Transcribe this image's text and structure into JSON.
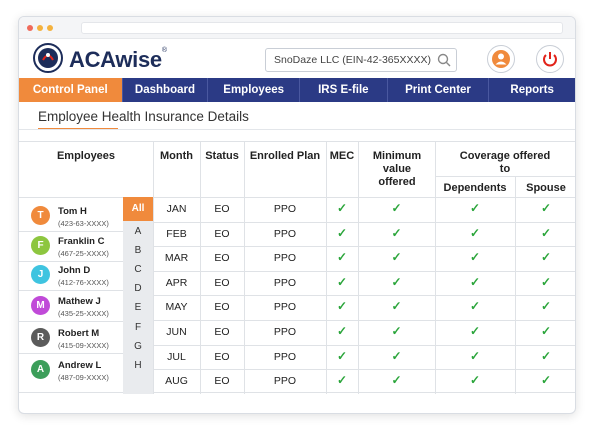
{
  "app": {
    "brand": "ACAwise",
    "brand_mark": "®",
    "company_selector": "SnoDaze LLC (EIN-42-365XXXX)"
  },
  "nav": {
    "tabs": [
      {
        "label": "Control Panel",
        "active": true
      },
      {
        "label": "Dashboard",
        "active": false
      },
      {
        "label": "Employees",
        "active": false
      },
      {
        "label": "IRS E-file",
        "active": false
      },
      {
        "label": "Print Center",
        "active": false
      },
      {
        "label": "Reports",
        "active": false
      }
    ]
  },
  "page": {
    "title": "Employee Health Insurance Details"
  },
  "table": {
    "headers": {
      "employees": "Employees",
      "month": "Month",
      "status": "Status",
      "plan": "Enrolled Plan",
      "mec": "MEC",
      "mv": "Minimum value offered",
      "coverage": "Coverage offered to",
      "dependents": "Dependents",
      "spouse": "Spouse"
    },
    "rows": [
      {
        "month": "JAN",
        "status": "EO",
        "plan": "PPO"
      },
      {
        "month": "FEB",
        "status": "EO",
        "plan": "PPO"
      },
      {
        "month": "MAR",
        "status": "EO",
        "plan": "PPO"
      },
      {
        "month": "APR",
        "status": "EO",
        "plan": "PPO"
      },
      {
        "month": "MAY",
        "status": "EO",
        "plan": "PPO"
      },
      {
        "month": "JUN",
        "status": "EO",
        "plan": "PPO"
      },
      {
        "month": "JUL",
        "status": "EO",
        "plan": "PPO"
      },
      {
        "month": "AUG",
        "status": "EO",
        "plan": "PPO"
      }
    ],
    "check_glyph": "✓"
  },
  "employees": [
    {
      "initial": "T",
      "name": "Tom H",
      "ssn": "(423-63-XXXX)",
      "color": "#f08a3c"
    },
    {
      "initial": "F",
      "name": "Franklin C",
      "ssn": "(467-25-XXXX)",
      "color": "#8dc63f"
    },
    {
      "initial": "J",
      "name": "John D",
      "ssn": "(412-76-XXXX)",
      "color": "#3fc4e0"
    },
    {
      "initial": "M",
      "name": "Mathew J",
      "ssn": "(435-25-XXXX)",
      "color": "#c04ad8"
    },
    {
      "initial": "R",
      "name": "Robert M",
      "ssn": "(415-09-XXXX)",
      "color": "#5b5b5b"
    },
    {
      "initial": "A",
      "name": "Andrew L",
      "ssn": "(487-09-XXXX)",
      "color": "#3c9e5a"
    }
  ],
  "alphabet": [
    "All",
    "A",
    "B",
    "C",
    "D",
    "E",
    "F",
    "G",
    "H"
  ],
  "colors": {
    "accent": "#f08a3c",
    "nav": "#2b3a85",
    "check": "#2aa53a",
    "power": "#e2231a"
  }
}
